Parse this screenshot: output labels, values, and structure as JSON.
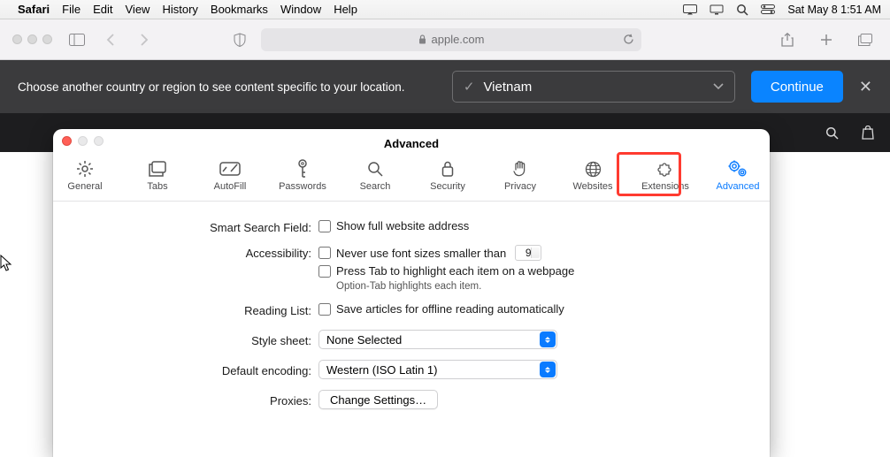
{
  "menubar": {
    "app": "Safari",
    "items": [
      "File",
      "Edit",
      "View",
      "History",
      "Bookmarks",
      "Window",
      "Help"
    ],
    "datetime": "Sat May 8  1:51 AM"
  },
  "toolbar": {
    "url_host": "apple.com"
  },
  "banner": {
    "message": "Choose another country or region to see content specific to your location.",
    "country": "Vietnam",
    "continue": "Continue"
  },
  "prefs": {
    "title": "Advanced",
    "tabs": [
      "General",
      "Tabs",
      "AutoFill",
      "Passwords",
      "Search",
      "Security",
      "Privacy",
      "Websites",
      "Extensions",
      "Advanced"
    ],
    "smart_search_label": "Smart Search Field:",
    "smart_search_opt": "Show full website address",
    "accessibility_label": "Accessibility:",
    "acc_opt1": "Never use font sizes smaller than",
    "acc_fontsize": "9",
    "acc_opt2": "Press Tab to highlight each item on a webpage",
    "acc_hint": "Option-Tab highlights each item.",
    "reading_label": "Reading List:",
    "reading_opt": "Save articles for offline reading automatically",
    "style_label": "Style sheet:",
    "style_value": "None Selected",
    "encoding_label": "Default encoding:",
    "encoding_value": "Western (ISO Latin 1)",
    "proxies_label": "Proxies:",
    "proxies_button": "Change Settings…"
  }
}
